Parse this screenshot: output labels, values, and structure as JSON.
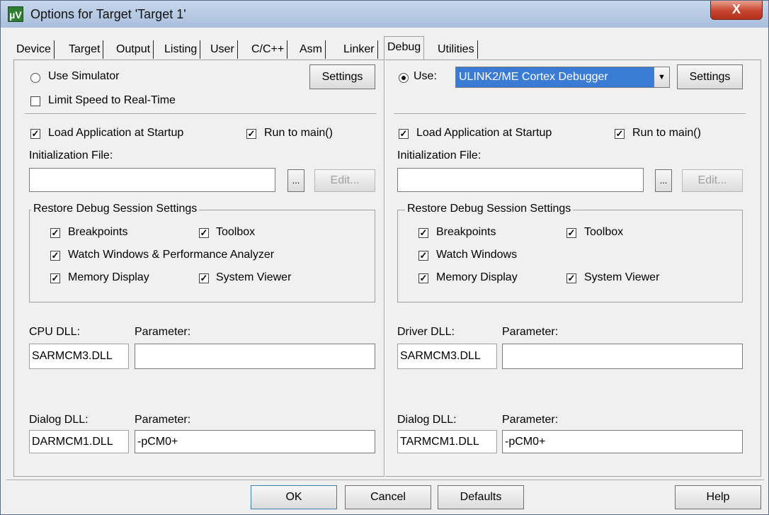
{
  "window": {
    "title": "Options for Target 'Target 1'",
    "app_icon": "µV",
    "close_glyph": "X"
  },
  "tabs": [
    "Device",
    "Target",
    "Output",
    "Listing",
    "User",
    "C/C++",
    "Asm",
    "Linker",
    "Debug",
    "Utilities"
  ],
  "active_tab": "Debug",
  "left": {
    "use_simulator": "Use Simulator",
    "settings": "Settings",
    "limit_speed": "Limit Speed to Real-Time",
    "load_app": "Load Application at Startup",
    "run_to_main": "Run to main()",
    "init_file_label": "Initialization File:",
    "init_file_value": "",
    "browse": "...",
    "edit": "Edit...",
    "restore_group": "Restore Debug Session Settings",
    "breakpoints": "Breakpoints",
    "toolbox": "Toolbox",
    "watch_windows": "Watch Windows & Performance Analyzer",
    "memory_display": "Memory Display",
    "system_viewer": "System Viewer",
    "dll_label": "CPU DLL:",
    "dll_value": "SARMCM3.DLL",
    "parameter_label": "Parameter:",
    "dll_param": "",
    "dialog_dll_label": "Dialog DLL:",
    "dialog_dll_value": "DARMCM1.DLL",
    "dialog_param_label": "Parameter:",
    "dialog_param": "-pCM0+"
  },
  "right": {
    "use": "Use:",
    "debugger": "ULINK2/ME Cortex Debugger",
    "settings": "Settings",
    "load_app": "Load Application at Startup",
    "run_to_main": "Run to main()",
    "init_file_label": "Initialization File:",
    "init_file_value": "",
    "browse": "...",
    "edit": "Edit...",
    "restore_group": "Restore Debug Session Settings",
    "breakpoints": "Breakpoints",
    "toolbox": "Toolbox",
    "watch_windows": "Watch Windows",
    "memory_display": "Memory Display",
    "system_viewer": "System Viewer",
    "dll_label": "Driver DLL:",
    "dll_value": "SARMCM3.DLL",
    "parameter_label": "Parameter:",
    "dll_param": "",
    "dialog_dll_label": "Dialog DLL:",
    "dialog_dll_value": "TARMCM1.DLL",
    "dialog_param_label": "Parameter:",
    "dialog_param": "-pCM0+"
  },
  "check_glyph": "✓",
  "footer": {
    "ok": "OK",
    "cancel": "Cancel",
    "defaults": "Defaults",
    "help": "Help"
  },
  "colors": {
    "selected_combo": "#3a7bd5",
    "close_button": "#c6452e"
  }
}
